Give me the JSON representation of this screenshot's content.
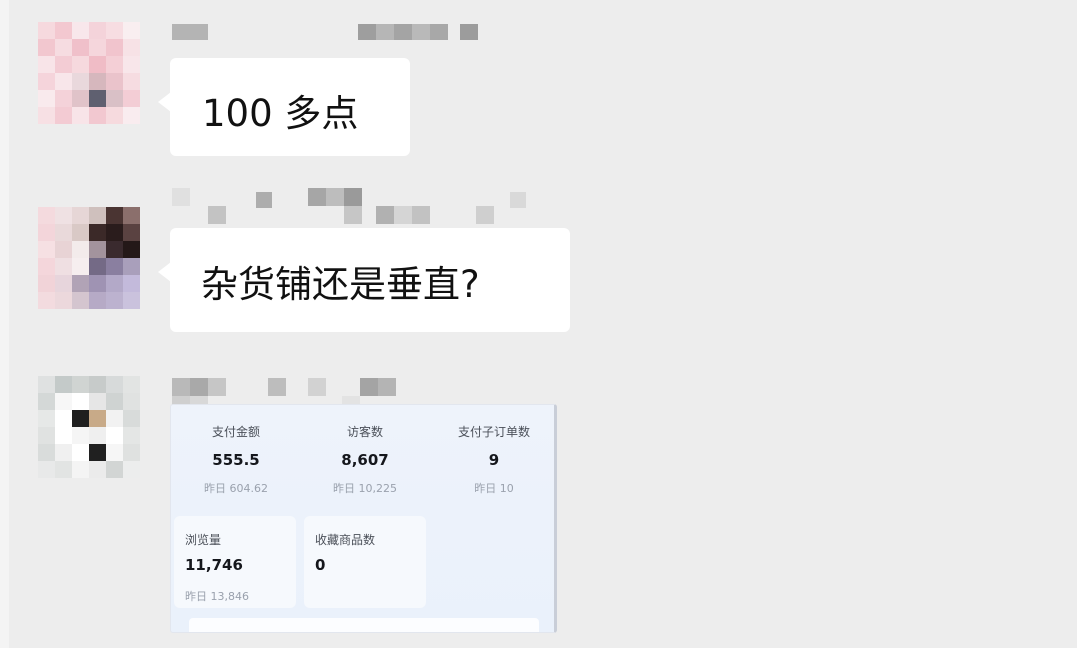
{
  "messages": [
    {
      "text": "100 多点"
    },
    {
      "text": "杂货铺还是垂直?"
    }
  ],
  "stats_card": {
    "metrics": [
      {
        "label": "支付金额",
        "value": "555.5",
        "yesterday": "昨日 604.62"
      },
      {
        "label": "访客数",
        "value": "8,607",
        "yesterday": "昨日 10,225"
      },
      {
        "label": "支付子订单数",
        "value": "9",
        "yesterday": "昨日 10"
      }
    ],
    "tiles": [
      {
        "label": "浏览量",
        "value": "11,746",
        "yesterday": "昨日 13,846"
      },
      {
        "label": "收藏商品数",
        "value": "0"
      }
    ]
  },
  "colors": {
    "background": "#ededed",
    "bubble": "#ffffff",
    "card": "#eef3fb",
    "label": "#4a4f58",
    "yesterday": "#9aa1ad"
  }
}
